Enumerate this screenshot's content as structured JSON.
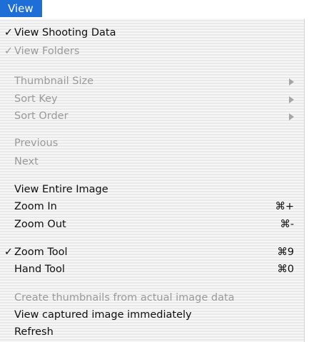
{
  "menu_title": "View",
  "items": [
    {
      "label": "View Shooting Data",
      "check": "✓",
      "shortcut": ""
    },
    {
      "label": "View Folders",
      "check": "✓",
      "shortcut": ""
    },
    {
      "label": "Thumbnail Size",
      "check": "",
      "shortcut": ""
    },
    {
      "label": "Sort Key",
      "check": "",
      "shortcut": ""
    },
    {
      "label": "Sort Order",
      "check": "",
      "shortcut": ""
    },
    {
      "label": "Previous",
      "check": "",
      "shortcut": ""
    },
    {
      "label": "Next",
      "check": "",
      "shortcut": ""
    },
    {
      "label": "View Entire Image",
      "check": "",
      "shortcut": ""
    },
    {
      "label": "Zoom In",
      "check": "",
      "shortcut": "⌘+"
    },
    {
      "label": "Zoom Out",
      "check": "",
      "shortcut": "⌘-"
    },
    {
      "label": "Zoom Tool",
      "check": "✓",
      "shortcut": "⌘9"
    },
    {
      "label": "Hand Tool",
      "check": "",
      "shortcut": "⌘0"
    },
    {
      "label": "Create thumbnails from actual image data",
      "check": "",
      "shortcut": ""
    },
    {
      "label": "View captured image immediately",
      "check": "",
      "shortcut": ""
    },
    {
      "label": "Refresh",
      "check": "",
      "shortcut": ""
    }
  ]
}
